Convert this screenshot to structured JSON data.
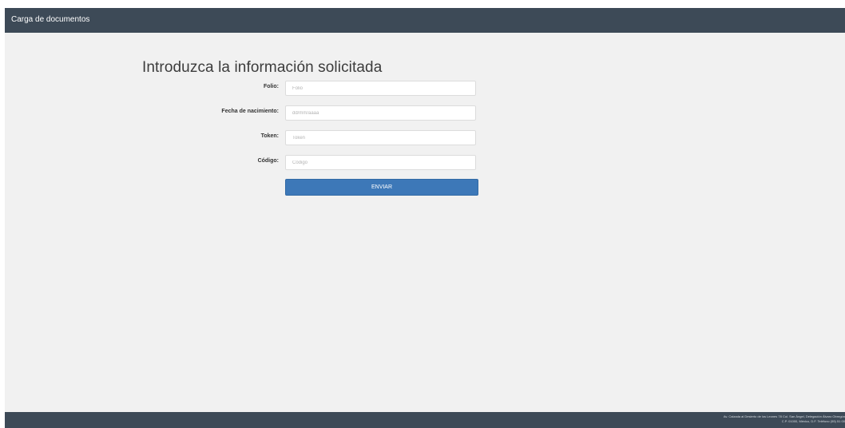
{
  "navbar": {
    "title": "Carga de documentos"
  },
  "form": {
    "heading": "Introduzca la información solicitada",
    "fields": [
      {
        "label": "Folio:",
        "placeholder": "Folio",
        "value": ""
      },
      {
        "label": "Fecha de nacimiento:",
        "placeholder": "dd/mm/aaaa",
        "value": ""
      },
      {
        "label": "Token:",
        "placeholder": "Token",
        "value": ""
      },
      {
        "label": "Código:",
        "placeholder": "Código",
        "value": ""
      }
    ],
    "submit_label": "ENVIAR"
  },
  "footer": {
    "line1": "Av. Calzada al Desierto de los Leones 78 Col. San Ángel, Delegación Álvaro Obregón",
    "line2": "C.P. 01000, México, D.F. Teléfono (55) 51 00"
  },
  "colors": {
    "navbar_bg": "#3d4a57",
    "page_bg": "#f1f1f1",
    "button_bg": "#3d78b8"
  }
}
